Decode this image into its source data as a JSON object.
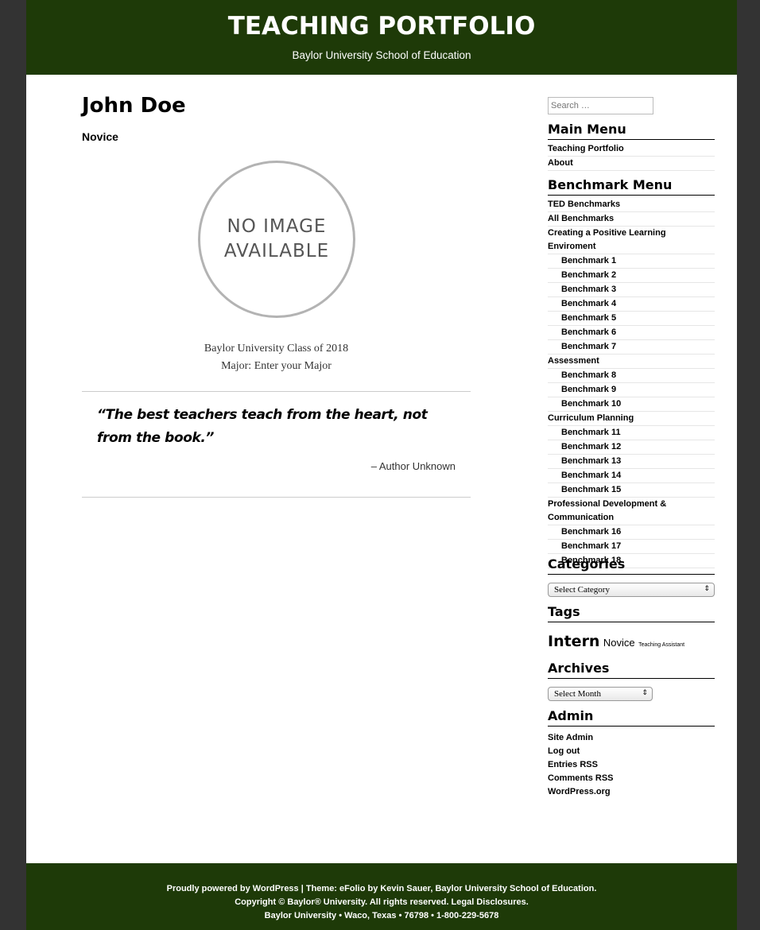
{
  "header": {
    "site_title": "TEACHING PORTFOLIO",
    "site_description": "Baylor University School of Education"
  },
  "main": {
    "name": "John Doe",
    "level": "Novice",
    "avatar_line1": "NO IMAGE",
    "avatar_line2": "AVAILABLE",
    "class_of": "Baylor University Class of 2018",
    "major": "Major: Enter your Major",
    "quote": "“The best teachers teach from the heart, not from the book.”",
    "quote_author": "– Author Unknown"
  },
  "sidebar": {
    "search_placeholder": "Search …",
    "main_menu_title": "Main Menu",
    "main_menu": [
      "Teaching Portfolio",
      "About"
    ],
    "benchmark_menu_title": "Benchmark Menu",
    "benchmark_menu": [
      {
        "label": "TED Benchmarks",
        "sub": false
      },
      {
        "label": "All Benchmarks",
        "sub": false
      },
      {
        "label": "Creating a Positive Learning Enviroment",
        "sub": false
      },
      {
        "label": "Benchmark 1",
        "sub": true
      },
      {
        "label": "Benchmark 2",
        "sub": true
      },
      {
        "label": "Benchmark 3",
        "sub": true
      },
      {
        "label": "Benchmark 4",
        "sub": true
      },
      {
        "label": "Benchmark 5",
        "sub": true
      },
      {
        "label": "Benchmark 6",
        "sub": true
      },
      {
        "label": "Benchmark 7",
        "sub": true
      },
      {
        "label": "Assessment",
        "sub": false
      },
      {
        "label": "Benchmark 8",
        "sub": true
      },
      {
        "label": "Benchmark 9",
        "sub": true
      },
      {
        "label": "Benchmark 10",
        "sub": true
      },
      {
        "label": "Curriculum Planning",
        "sub": false
      },
      {
        "label": "Benchmark 11",
        "sub": true
      },
      {
        "label": "Benchmark 12",
        "sub": true
      },
      {
        "label": "Benchmark 13",
        "sub": true
      },
      {
        "label": "Benchmark 14",
        "sub": true
      },
      {
        "label": "Benchmark 15",
        "sub": true
      },
      {
        "label": "Professional Development &",
        "sub": false,
        "cont": true
      },
      {
        "label": "Communication",
        "sub": false
      },
      {
        "label": "Benchmark 16",
        "sub": true
      },
      {
        "label": "Benchmark 17",
        "sub": true
      },
      {
        "label": "Benchmark 18",
        "sub": true
      }
    ],
    "categories_title": "Categories",
    "categories_select": "Select Category",
    "tags_title": "Tags",
    "tags": {
      "large": "Intern",
      "medium": "Novice",
      "small": "Teaching Assistant"
    },
    "archives_title": "Archives",
    "archives_select": "Select Month",
    "admin_title": "Admin",
    "admin_links": [
      "Site Admin",
      "Log out",
      "Entries RSS",
      "Comments RSS",
      "WordPress.org"
    ]
  },
  "footer": {
    "line1": "Proudly powered by WordPress | Theme: eFolio by Kevin Sauer, Baylor University School of Education.",
    "line2": "Copyright © Baylor® University. All rights reserved. Legal Disclosures.",
    "line3": "Baylor University • Waco, Texas • 76798 • 1-800-229-5678"
  }
}
